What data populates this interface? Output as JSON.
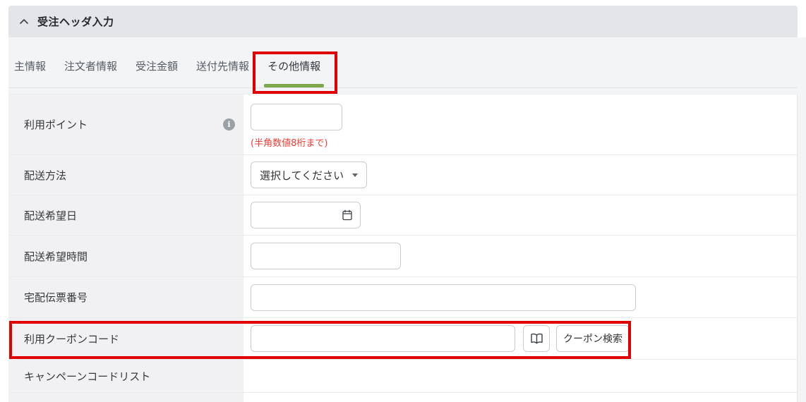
{
  "header": {
    "title": "受注ヘッダ入力"
  },
  "tabs": {
    "items": [
      {
        "label": "主情報"
      },
      {
        "label": "注文者情報"
      },
      {
        "label": "受注金額"
      },
      {
        "label": "送付先情報"
      },
      {
        "label": "その他情報"
      }
    ],
    "active_index": 4
  },
  "form": {
    "rows": [
      {
        "label": "利用ポイント",
        "note": "(半角数値8桁まで)",
        "value": "",
        "has_info_icon": true
      },
      {
        "label": "配送方法",
        "select_value": "選択してください"
      },
      {
        "label": "配送希望日",
        "value": ""
      },
      {
        "label": "配送希望時間",
        "value": ""
      },
      {
        "label": "宅配伝票番号",
        "value": ""
      },
      {
        "label": "利用クーポンコード",
        "value": "",
        "search_button_label": "クーポン検索"
      },
      {
        "label": "キャンペーンコードリスト"
      }
    ]
  },
  "annotations": {
    "highlighted_tab": "その他情報",
    "highlighted_row": "利用クーポンコード"
  },
  "colors": {
    "accent_green": "#7ca84b",
    "annotation_red": "#e00000",
    "note_red": "#f03d33",
    "header_bar": "#e3e5e8"
  }
}
